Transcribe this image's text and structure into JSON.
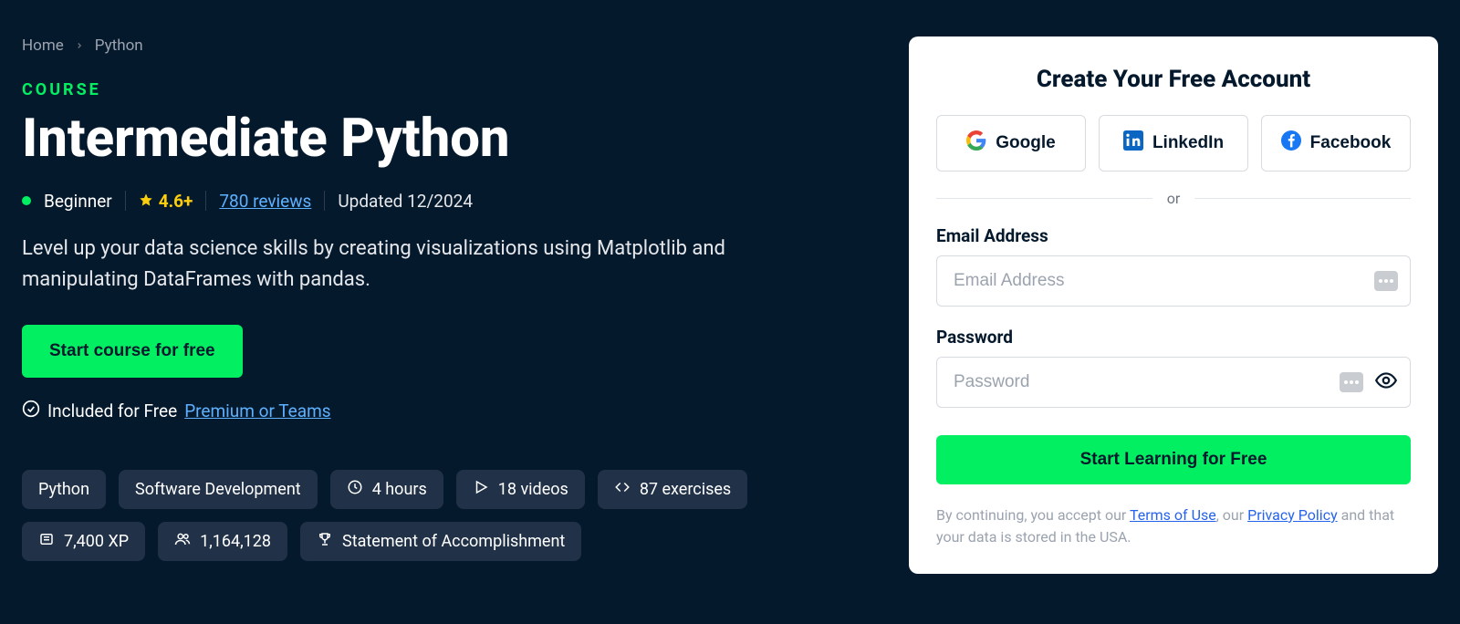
{
  "breadcrumb": {
    "home": "Home",
    "current": "Python"
  },
  "course": {
    "label": "COURSE",
    "title": "Intermediate Python",
    "level": "Beginner",
    "rating": "4.6+",
    "reviews": "780 reviews",
    "updated": "Updated 12/2024",
    "description": "Level up your data science skills by creating visualizations using Matplotlib and manipulating DataFrames with pandas.",
    "cta": "Start course for free",
    "included_prefix": "Included for Free",
    "included_link": "Premium or Teams"
  },
  "chips": {
    "python": "Python",
    "softdev": "Software Development",
    "hours": "4 hours",
    "videos": "18 videos",
    "exercises": "87 exercises",
    "xp": "7,400 XP",
    "learners": "1,164,128",
    "statement": "Statement of Accomplishment"
  },
  "signup": {
    "title": "Create Your Free Account",
    "google": "Google",
    "linkedin": "LinkedIn",
    "facebook": "Facebook",
    "or": "or",
    "email_label": "Email Address",
    "email_placeholder": "Email Address",
    "password_label": "Password",
    "password_placeholder": "Password",
    "submit": "Start Learning for Free",
    "terms_prefix": "By continuing, you accept our ",
    "terms_of_use": "Terms of Use",
    "terms_mid": ", our ",
    "privacy": "Privacy Policy",
    "terms_suffix": " and that your data is stored in the USA."
  }
}
